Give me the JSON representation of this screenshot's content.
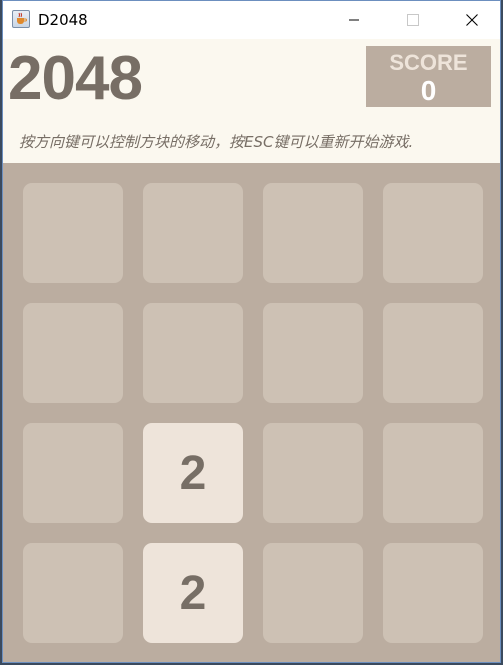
{
  "window": {
    "title": "D2048",
    "icon": "java-cup-icon"
  },
  "controls": {
    "minimize_icon": "minimize-icon",
    "maximize_icon": "maximize-icon",
    "close_icon": "close-icon"
  },
  "header": {
    "title": "2048",
    "score_label": "SCORE",
    "score_value": "0",
    "instructions": "按方向键可以控制方块的移动，按ESC键可以重新开始游戏."
  },
  "board": {
    "rows": [
      [
        "",
        "",
        "",
        ""
      ],
      [
        "",
        "",
        "",
        ""
      ],
      [
        "",
        "2",
        "",
        ""
      ],
      [
        "",
        "2",
        "",
        ""
      ]
    ]
  },
  "colors": {
    "board": "#bbada0",
    "empty_tile": "#cdc1b4",
    "tile_2": "#eee4da",
    "text_dark": "#776e65",
    "header_bg": "#fbf8ef"
  }
}
